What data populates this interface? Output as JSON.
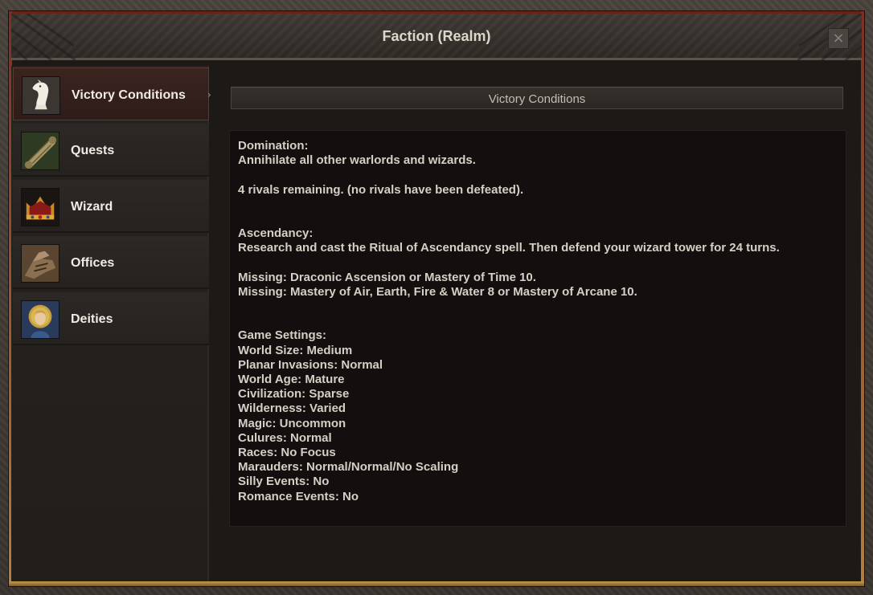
{
  "window": {
    "title": "Faction (Realm)"
  },
  "close_icon": "×",
  "sidebar": {
    "items": [
      {
        "label": "Victory Conditions",
        "icon": "chess-knight-icon",
        "active": true
      },
      {
        "label": "Quests",
        "icon": "scroll-icon",
        "active": false
      },
      {
        "label": "Wizard",
        "icon": "crown-icon",
        "active": false
      },
      {
        "label": "Offices",
        "icon": "gauntlet-icon",
        "active": false
      },
      {
        "label": "Deities",
        "icon": "saint-portrait-icon",
        "active": false
      }
    ],
    "arrow": "›"
  },
  "main": {
    "header": "Victory Conditions",
    "lines": [
      "Domination:",
      "Annihilate all other warlords and wizards.",
      "",
      "4 rivals remaining. (no rivals have been defeated).",
      "",
      "",
      "Ascendancy:",
      "Research and cast the Ritual of Ascendancy spell. Then defend your wizard tower for 24 turns.",
      "",
      "Missing: Draconic Ascension or Mastery of Time 10.",
      "Missing: Mastery of Air, Earth, Fire & Water 8 or Mastery of Arcane 10.",
      "",
      "",
      "Game Settings:",
      "World Size: Medium",
      "Planar Invasions: Normal",
      "World Age: Mature",
      "Civilization: Sparse",
      "Wilderness: Varied",
      "Magic: Uncommon",
      "Culures: Normal",
      "Races: No Focus",
      "Marauders: Normal/Normal/No Scaling",
      "Silly Events: No",
      "Romance Events: No"
    ]
  },
  "colors": {
    "frame_red": "#6b2018",
    "gold_trim": "#c89a4a",
    "text": "#d5cfc5",
    "content_bg": "#120f0e"
  }
}
